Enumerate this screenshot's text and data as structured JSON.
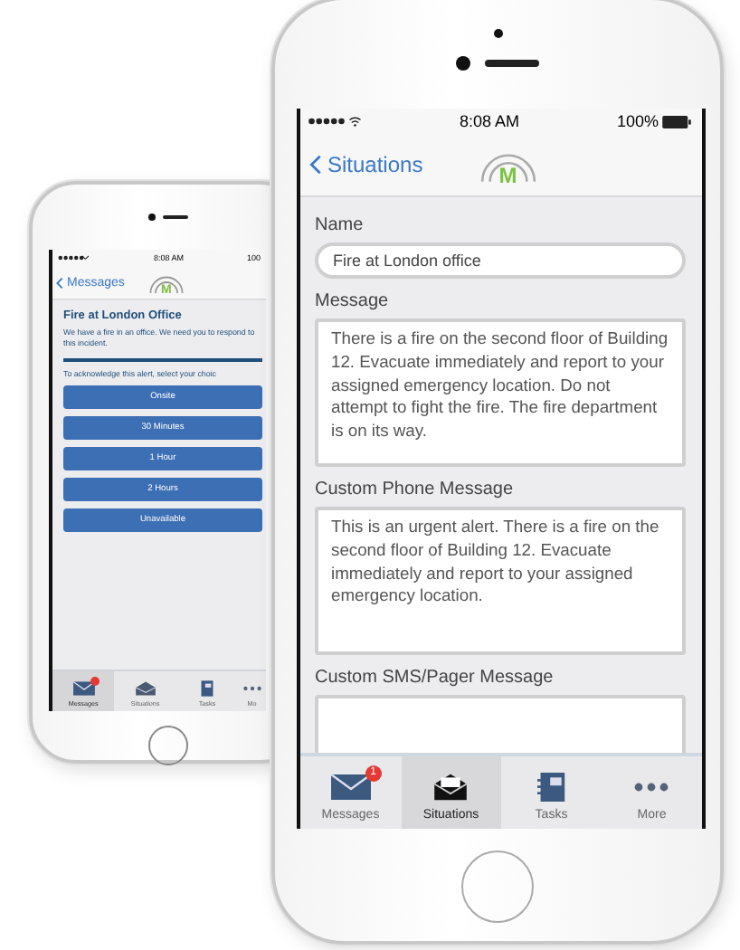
{
  "back_phone": {
    "status_bar": {
      "time": "8:08 AM",
      "battery": "100"
    },
    "nav": {
      "back": "Messages",
      "logo_letter": "M"
    },
    "title": "Fire at London Office",
    "body": "We have a fire in an office. We need you to respond to this incident.",
    "prompt": "To acknowledge this alert, select your choic",
    "choices": [
      "Onsite",
      "30 Minutes",
      "1 Hour",
      "2 Hours",
      "Unavailable"
    ],
    "tabs": [
      {
        "label": "Messages",
        "badge_dot": true,
        "selected": true
      },
      {
        "label": "Situations",
        "badge_dot": false,
        "selected": false
      },
      {
        "label": "Tasks",
        "badge_dot": false,
        "selected": false
      },
      {
        "label": "Mo",
        "badge_dot": false,
        "selected": false
      }
    ]
  },
  "front_phone": {
    "status_bar": {
      "time": "8:08 AM",
      "battery": "100%"
    },
    "nav": {
      "back": "Situations",
      "logo_letter": "M"
    },
    "fields": [
      {
        "label": "Name",
        "kind": "line",
        "value": "Fire at London office"
      },
      {
        "label": "Message",
        "kind": "area",
        "value": "There is a fire on the second floor of Building 12. Evacuate immediately and report to your assigned emergency location. Do not attempt to fight the fire. The fire department is on its way."
      },
      {
        "label": "Custom Phone Message",
        "kind": "area",
        "value": "This is an urgent alert. There is a fire on the second floor of Building 12. Evacuate immediately and report to your assigned emergency location."
      },
      {
        "label": "Custom SMS/Pager Message",
        "kind": "area"
      }
    ],
    "tabs": [
      {
        "label": "Messages",
        "badge": "1",
        "selected": false
      },
      {
        "label": "Situations",
        "selected": true
      },
      {
        "label": "Tasks",
        "selected": false
      },
      {
        "label": "More",
        "selected": false
      }
    ]
  }
}
